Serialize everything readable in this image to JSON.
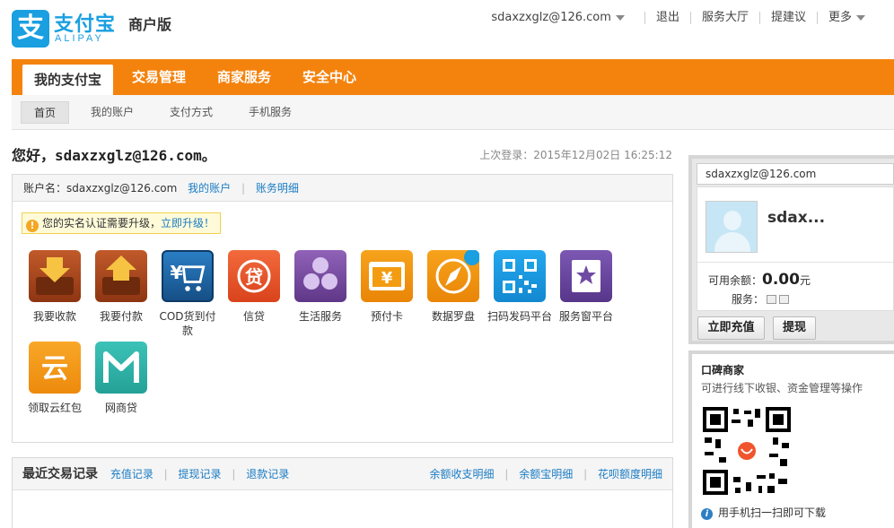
{
  "brand": {
    "logo_glyph": "支",
    "name_cn": "支付宝",
    "name_en": "ALIPAY",
    "edition": "商户版",
    "color": "#1a9fe0"
  },
  "topnav": {
    "user": "sdaxzxglz@126.com",
    "items": [
      "退出",
      "服务大厅",
      "提建议",
      "更多"
    ]
  },
  "mainnav": {
    "accent": "#f4830e",
    "tabs": [
      "我的支付宝",
      "交易管理",
      "商家服务",
      "安全中心"
    ]
  },
  "subnav": {
    "tabs": [
      "首页",
      "我的账户",
      "支付方式",
      "手机服务"
    ]
  },
  "greeting": "您好，sdaxzxglz@126.com。",
  "last_login": "上次登录：2015年12月02日 16:25:12",
  "account": {
    "label": "账户名：sdaxzxglz@126.com",
    "links": [
      "我的账户",
      "账务明细"
    ],
    "notice_text": "您的实名认证需要升级，",
    "notice_link": "立即升级！",
    "apps": [
      {
        "label": "我要收款",
        "icon": "receive-money-icon",
        "color": "#a0441c"
      },
      {
        "label": "我要付款",
        "icon": "pay-money-icon",
        "color": "#a0441c"
      },
      {
        "label": "COD货到付款",
        "icon": "cod-cart-icon",
        "color": "#1f6fb5"
      },
      {
        "label": "信贷",
        "icon": "credit-icon",
        "color": "#e8542b"
      },
      {
        "label": "生活服务",
        "icon": "life-service-icon",
        "color": "#7b4aa0"
      },
      {
        "label": "预付卡",
        "icon": "prepaid-card-icon",
        "color": "#f39c12"
      },
      {
        "label": "数据罗盘",
        "icon": "compass-icon",
        "color": "#f39c12"
      },
      {
        "label": "扫码发码平台",
        "icon": "qrcode-icon",
        "color": "#1a9fe0"
      },
      {
        "label": "服务窗平台",
        "icon": "service-window-icon",
        "color": "#6f4ba3"
      },
      {
        "label": "领取云红包",
        "icon": "cloud-redpacket-icon",
        "color": "#f39c12"
      },
      {
        "label": "网商贷",
        "icon": "mybank-loan-icon",
        "color": "#2fb3a9"
      }
    ]
  },
  "recent": {
    "title": "最近交易记录",
    "left_links": [
      "充值记录",
      "提现记录",
      "退款记录"
    ],
    "right_links": [
      "余额收支明细",
      "余额宝明细",
      "花呗额度明细"
    ]
  },
  "sidebar": {
    "email": "sdaxzxglz@126.com",
    "nickname": "sdax...",
    "balance_label": "可用余额：",
    "balance_value": "0.00",
    "balance_unit": "元",
    "service_label": "服务：",
    "recharge_button": "立即充值",
    "withdraw_button": "提现"
  },
  "koubei": {
    "title": "口碑商家",
    "desc": "可进行线下收银、资金管理等操作",
    "tip": "用手机扫一扫即可下载"
  }
}
